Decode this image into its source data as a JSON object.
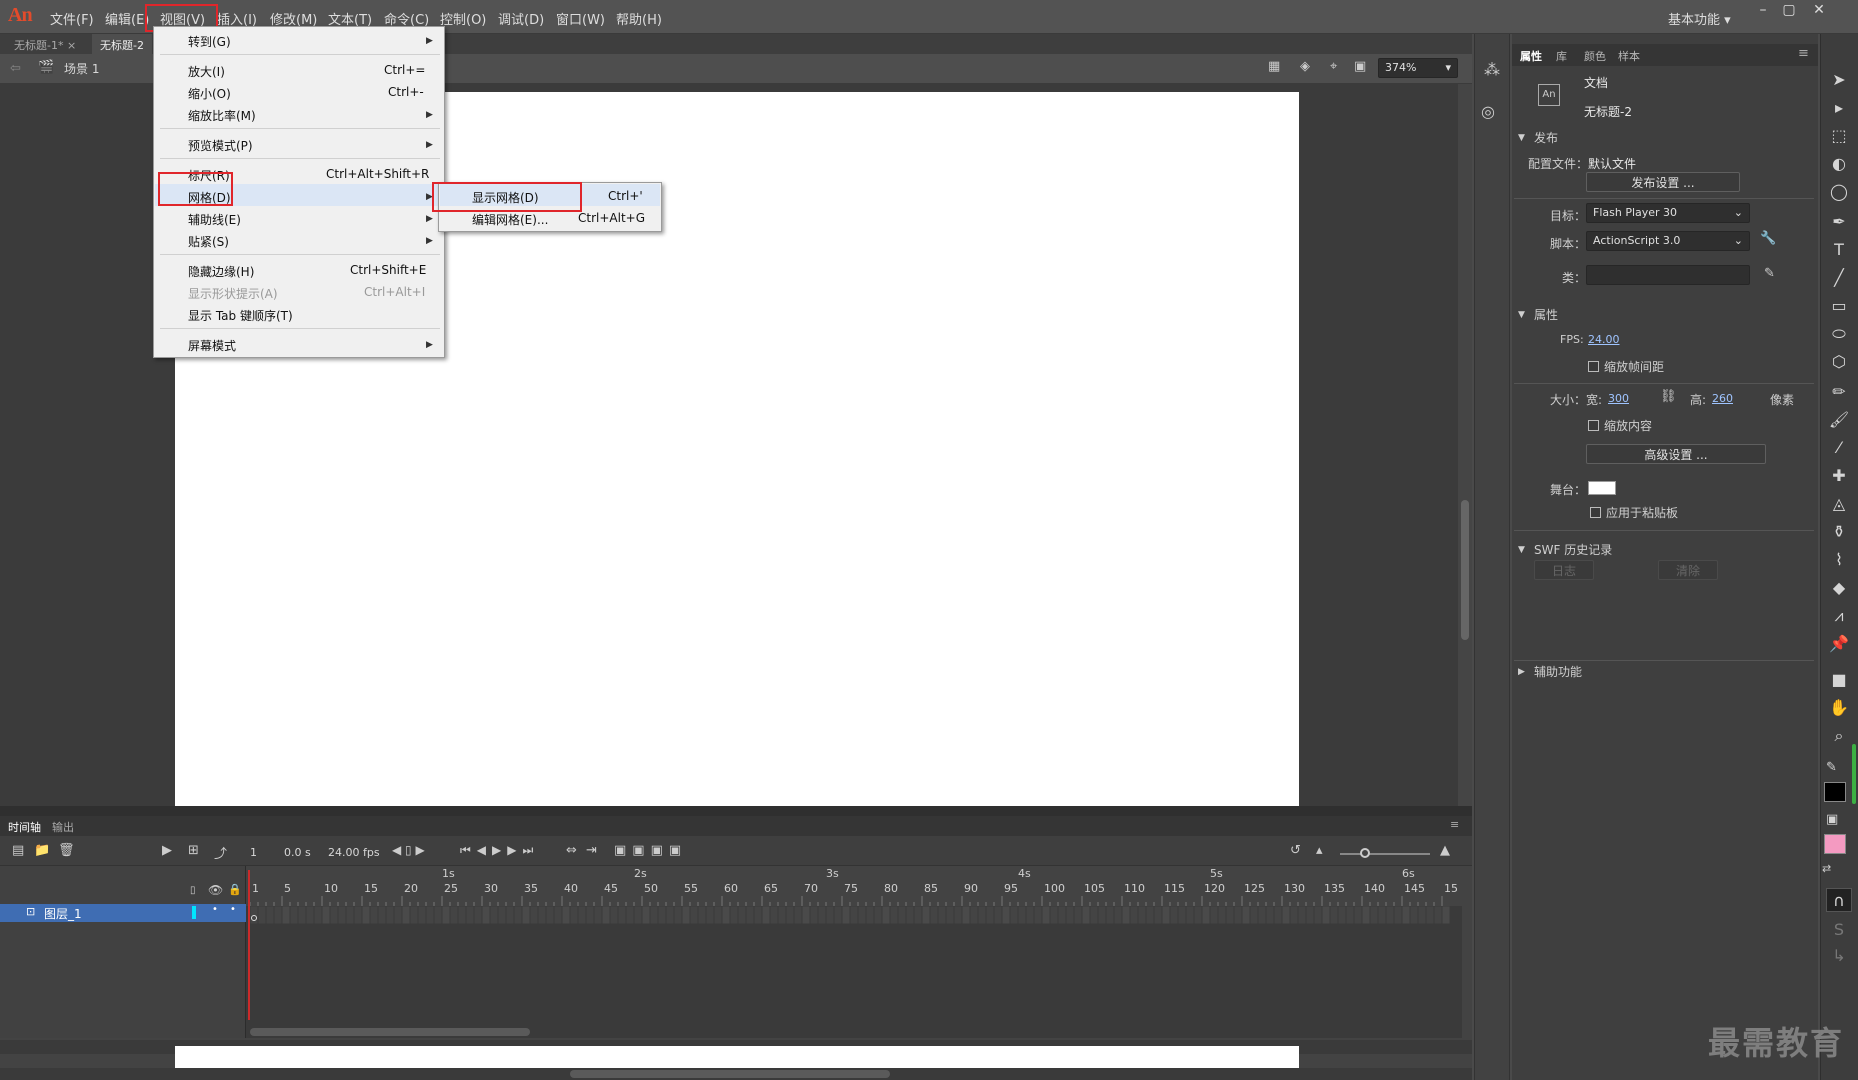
{
  "app": {
    "logo": "An"
  },
  "menubar": {
    "items": [
      "文件(F)",
      "编辑(E)",
      "视图(V)",
      "插入(I)",
      "修改(M)",
      "文本(T)",
      "命令(C)",
      "控制(O)",
      "调试(D)",
      "窗口(W)",
      "帮助(H)"
    ],
    "workspace": "基本功能"
  },
  "tabs": [
    {
      "label": "无标题-1*"
    },
    {
      "label": "无标题-2"
    }
  ],
  "scene": {
    "label": "场景 1",
    "zoom": "374%"
  },
  "view_menu": {
    "items": [
      {
        "label": "转到(G)",
        "shortcut": ""
      },
      {
        "label": "放大(I)",
        "shortcut": "Ctrl+="
      },
      {
        "label": "缩小(O)",
        "shortcut": "Ctrl+-"
      },
      {
        "label": "缩放比率(M)",
        "shortcut": ""
      },
      {
        "label": "预览模式(P)",
        "shortcut": ""
      },
      {
        "label": "标尺(R)",
        "shortcut": "Ctrl+Alt+Shift+R"
      },
      {
        "label": "网格(D)",
        "shortcut": ""
      },
      {
        "label": "辅助线(E)",
        "shortcut": ""
      },
      {
        "label": "贴紧(S)",
        "shortcut": ""
      },
      {
        "label": "隐藏边缘(H)",
        "shortcut": "Ctrl+Shift+E"
      },
      {
        "label": "显示形状提示(A)",
        "shortcut": "Ctrl+Alt+I"
      },
      {
        "label": "显示 Tab 键顺序(T)",
        "shortcut": ""
      },
      {
        "label": "屏幕模式",
        "shortcut": ""
      }
    ]
  },
  "grid_submenu": {
    "items": [
      {
        "label": "显示网格(D)",
        "shortcut": "Ctrl+'"
      },
      {
        "label": "编辑网格(E)...",
        "shortcut": "Ctrl+Alt+G"
      }
    ]
  },
  "properties": {
    "tabs": [
      "属性",
      "库",
      "颜色",
      "样本"
    ],
    "doc_type": "文档",
    "doc_name": "无标题-2",
    "doc_icon": "An",
    "publish_header": "发布",
    "profile_label": "配置文件：",
    "profile_value": "默认文件",
    "publish_settings": "发布设置 ...",
    "target_label": "目标：",
    "target_value": "Flash Player 30",
    "script_label": "脚本：",
    "script_value": "ActionScript 3.0",
    "class_label": "类：",
    "props_header": "属性",
    "fps_label": "FPS:",
    "fps_value": "24.00",
    "scale_spans": "缩放帧间距",
    "size_label": "大小：",
    "width_label": "宽:",
    "width_value": "300",
    "height_label": "高:",
    "height_value": "260",
    "unit": "像素",
    "scale_content": "缩放内容",
    "advanced": "高级设置 ...",
    "stage_label": "舞台：",
    "stage_color": "#ffffff",
    "apply_pasteboard": "应用于粘贴板",
    "swf_header": "SWF 历史记录",
    "log_btn": "日志",
    "clear_btn": "清除",
    "access_header": "辅助功能"
  },
  "timeline": {
    "tabs": [
      "时间轴",
      "输出"
    ],
    "frame": "1",
    "time": "0.0 s",
    "fps": "24.00 fps",
    "seconds": [
      "1s",
      "2s",
      "3s",
      "4s",
      "5s",
      "6s"
    ],
    "ticks": [
      "1",
      "5",
      "10",
      "15",
      "20",
      "25",
      "30",
      "35",
      "40",
      "45",
      "50",
      "55",
      "60",
      "65",
      "70",
      "75",
      "80",
      "85",
      "90",
      "95",
      "100",
      "105",
      "110",
      "115",
      "120",
      "125",
      "130",
      "135",
      "140",
      "145",
      "15"
    ],
    "layer": "图层_1"
  },
  "colors": {
    "stroke": "#000000",
    "fill": "#f49ac1",
    "highlight": "#e0262b"
  },
  "watermark": "最需教育"
}
